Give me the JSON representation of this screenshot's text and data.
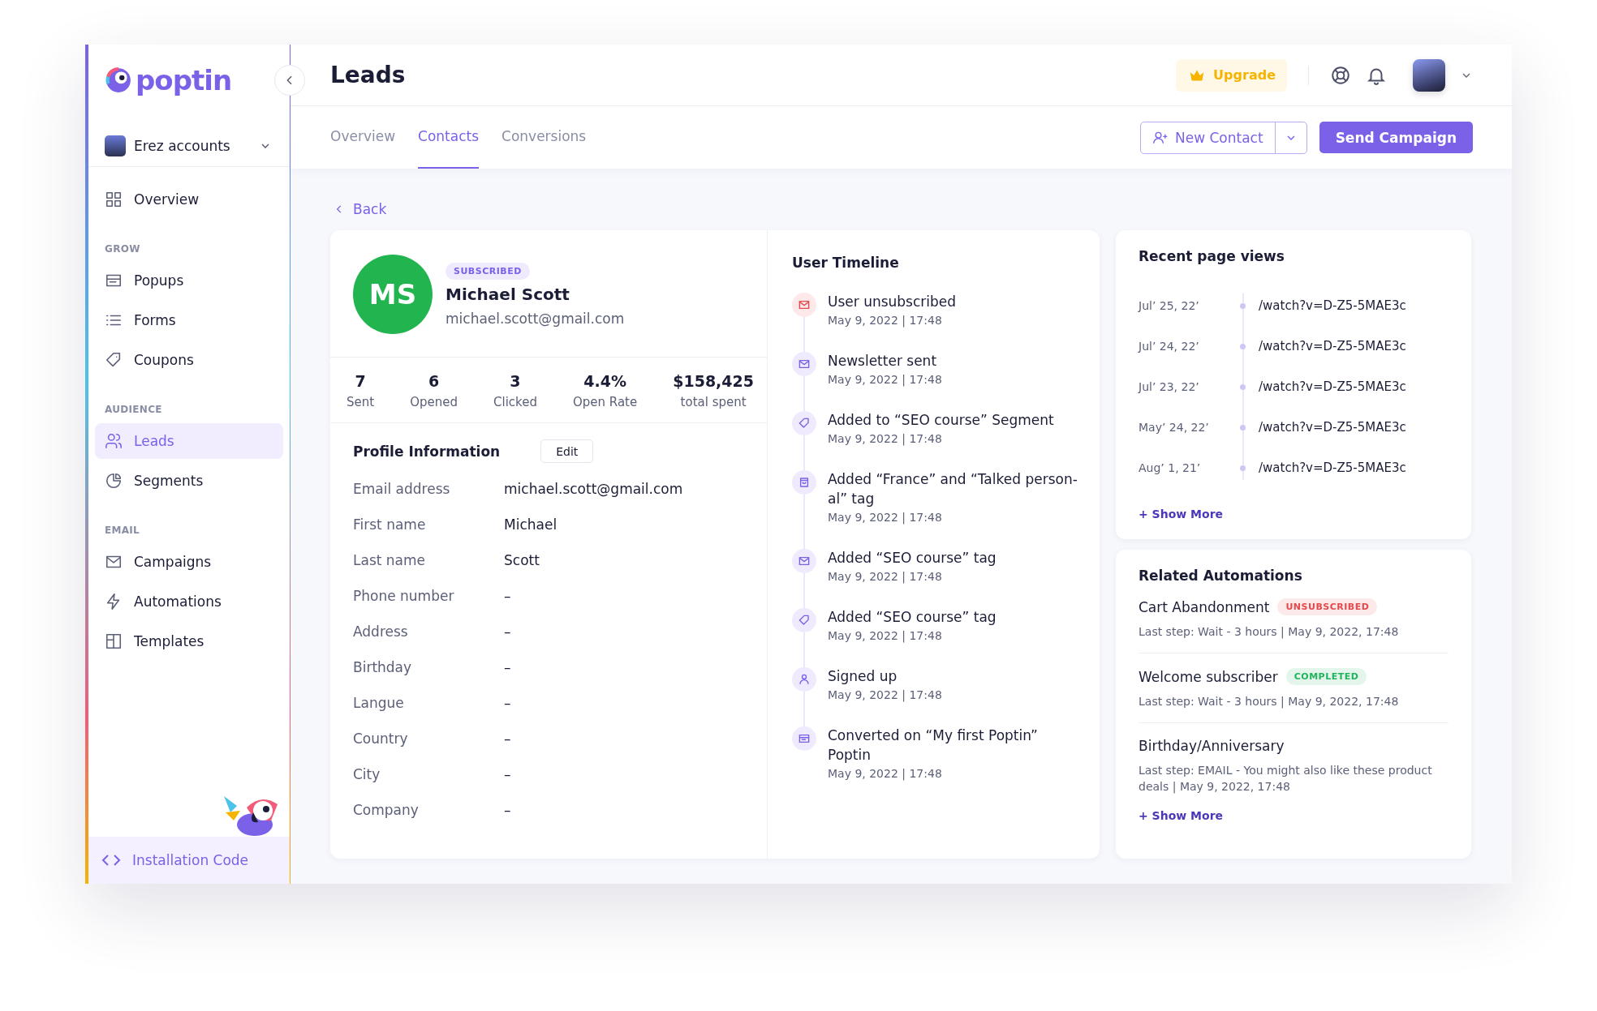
{
  "brand": {
    "name": "poptin"
  },
  "account": {
    "name": "Erez accounts"
  },
  "sidebar": {
    "sections": [
      {
        "items": [
          {
            "label": "Overview",
            "selected": false
          }
        ]
      },
      {
        "heading": "GROW",
        "items": [
          {
            "label": "Popups",
            "selected": false
          },
          {
            "label": "Forms",
            "selected": false
          },
          {
            "label": "Coupons",
            "selected": false
          }
        ]
      },
      {
        "heading": "AUDIENCE",
        "items": [
          {
            "label": "Leads",
            "selected": true
          },
          {
            "label": "Segments",
            "selected": false
          }
        ]
      },
      {
        "heading": "EMAIL",
        "items": [
          {
            "label": "Campaigns",
            "selected": false
          },
          {
            "label": "Automations",
            "selected": false
          },
          {
            "label": "Templates",
            "selected": false
          }
        ]
      }
    ],
    "footer": {
      "label": "Installation Code"
    }
  },
  "header": {
    "title": "Leads",
    "upgrade": "Upgrade"
  },
  "tabs": [
    {
      "label": "Overview",
      "selected": false
    },
    {
      "label": "Contacts",
      "selected": true
    },
    {
      "label": "Conversions",
      "selected": false
    }
  ],
  "actions": {
    "new_contact": "New Contact",
    "send_campaign": "Send Campaign"
  },
  "back": "Back",
  "contact": {
    "initials": "MS",
    "status": "SUBSCRIBED",
    "name": "Michael Scott",
    "email": "michael.scott@gmail.com",
    "stats": [
      {
        "value": "7",
        "label": "Sent"
      },
      {
        "value": "6",
        "label": "Opened"
      },
      {
        "value": "3",
        "label": "Clicked"
      },
      {
        "value": "4.4%",
        "label": "Open Rate"
      },
      {
        "value": "$158,425",
        "label": "total spent"
      }
    ]
  },
  "profile": {
    "title": "Profile Information",
    "edit": "Edit",
    "fields": [
      {
        "label": "Email address",
        "value": "michael.scott@gmail.com"
      },
      {
        "label": "First name",
        "value": "Michael"
      },
      {
        "label": "Last name",
        "value": "Scott"
      },
      {
        "label": "Phone number",
        "value": "–"
      },
      {
        "label": "Address",
        "value": "–"
      },
      {
        "label": "Birthday",
        "value": "–"
      },
      {
        "label": "Langue",
        "value": "–"
      },
      {
        "label": "Country",
        "value": "–"
      },
      {
        "label": "City",
        "value": "–"
      },
      {
        "label": "Company",
        "value": "–"
      }
    ]
  },
  "timeline": {
    "title": "User Timeline",
    "events": [
      {
        "kind": "unsubscribe",
        "text": "User unsubscribed",
        "time": "May 9, 2022 | 17:48"
      },
      {
        "kind": "mail",
        "text": "Newsletter sent",
        "time": "May 9, 2022 | 17:48"
      },
      {
        "kind": "tag",
        "text": "Added to “SEO course” Segment",
        "time": "May 9, 2022 | 17:48"
      },
      {
        "kind": "bag",
        "text": "Added “France” and “Talked person-al” tag",
        "time": "May 9, 2022 | 17:48"
      },
      {
        "kind": "mail",
        "text": "Added “SEO course” tag",
        "time": "May 9, 2022 | 17:48"
      },
      {
        "kind": "tag",
        "text": "Added “SEO course” tag",
        "time": "May 9, 2022 | 17:48"
      },
      {
        "kind": "user",
        "text": "Signed up",
        "time": "May 9, 2022 | 17:48"
      },
      {
        "kind": "popup",
        "text": "Converted on “My first Poptin” Poptin",
        "time": "May 9, 2022 | 17:48"
      }
    ]
  },
  "page_views": {
    "title": "Recent page views",
    "rows": [
      {
        "date": "Jul’ 25, 22’",
        "url": "/watch?v=D-Z5-5MAE3c"
      },
      {
        "date": "Jul’ 24, 22’",
        "url": "/watch?v=D-Z5-5MAE3c"
      },
      {
        "date": "Jul’ 23, 22’",
        "url": "/watch?v=D-Z5-5MAE3c"
      },
      {
        "date": "May’ 24, 22’",
        "url": "/watch?v=D-Z5-5MAE3c"
      },
      {
        "date": "Aug’ 1, 21’",
        "url": "/watch?v=D-Z5-5MAE3c"
      }
    ],
    "more": "+ Show More"
  },
  "automations": {
    "title": "Related Automations",
    "items": [
      {
        "name": "Cart Abandonment",
        "status": "UNSUBSCRIBED",
        "color": "#e5484d",
        "detail": "Last step: Wait - 3 hours | May 9, 2022, 17:48"
      },
      {
        "name": "Welcome subscriber",
        "status": "COMPLETED",
        "color": "#22b35e",
        "detail": "Last step: Wait - 3 hours | May 9, 2022, 17:48"
      },
      {
        "name": "Birthday/Anniversary",
        "detail": "Last step: EMAIL - You might also like these product deals | May 9, 2022, 17:48"
      }
    ],
    "more": "+ Show More"
  }
}
